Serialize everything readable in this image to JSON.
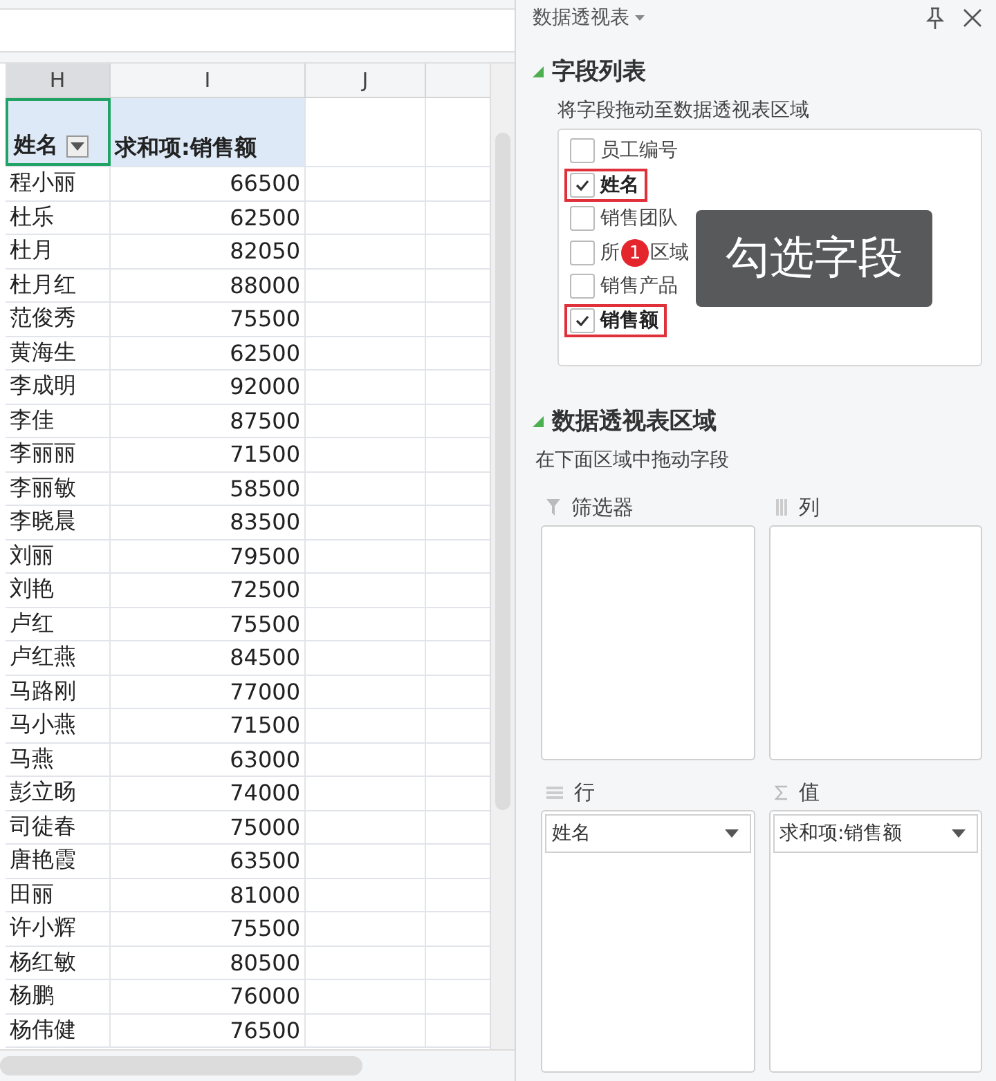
{
  "sheet": {
    "columns": [
      {
        "label": "H",
        "selected": true
      },
      {
        "label": "I",
        "selected": false
      },
      {
        "label": "J",
        "selected": false
      }
    ],
    "pivot_header": {
      "row_label": "姓名",
      "value_label": "求和项:销售额"
    },
    "rows": [
      {
        "name": "程小丽",
        "value": "66500"
      },
      {
        "name": "杜乐",
        "value": "62500"
      },
      {
        "name": "杜月",
        "value": "82050"
      },
      {
        "name": "杜月红",
        "value": "88000"
      },
      {
        "name": "范俊秀",
        "value": "75500"
      },
      {
        "name": "黄海生",
        "value": "62500"
      },
      {
        "name": "李成明",
        "value": "92000"
      },
      {
        "name": "李佳",
        "value": "87500"
      },
      {
        "name": "李丽丽",
        "value": "71500"
      },
      {
        "name": "李丽敏",
        "value": "58500"
      },
      {
        "name": "李晓晨",
        "value": "83500"
      },
      {
        "name": "刘丽",
        "value": "79500"
      },
      {
        "name": "刘艳",
        "value": "72500"
      },
      {
        "name": "卢红",
        "value": "75500"
      },
      {
        "name": "卢红燕",
        "value": "84500"
      },
      {
        "name": "马路刚",
        "value": "77000"
      },
      {
        "name": "马小燕",
        "value": "71500"
      },
      {
        "name": "马燕",
        "value": "63000"
      },
      {
        "name": "彭立旸",
        "value": "74000"
      },
      {
        "name": "司徒春",
        "value": "75000"
      },
      {
        "name": "唐艳霞",
        "value": "63500"
      },
      {
        "name": "田丽",
        "value": "81000"
      },
      {
        "name": "许小辉",
        "value": "75500"
      },
      {
        "name": "杨红敏",
        "value": "80500"
      },
      {
        "name": "杨鹏",
        "value": "76000"
      },
      {
        "name": "杨伟健",
        "value": "76500"
      }
    ]
  },
  "panel": {
    "title": "数据透视表",
    "field_list": {
      "heading": "字段列表",
      "hint": "将字段拖动至数据透视表区域",
      "fields": [
        {
          "label": "员工编号",
          "checked": false,
          "highlighted": false
        },
        {
          "label": "姓名",
          "checked": true,
          "highlighted": true
        },
        {
          "label": "销售团队",
          "checked": false,
          "highlighted": false
        },
        {
          "label": "所",
          "label_tail": "区域",
          "checked": false,
          "highlighted": false
        },
        {
          "label": "销售产品",
          "checked": false,
          "highlighted": false
        },
        {
          "label": "销售额",
          "checked": true,
          "highlighted": true
        }
      ]
    },
    "areas": {
      "heading": "数据透视表区域",
      "hint": "在下面区域中拖动字段",
      "zones": [
        {
          "kind": "filter",
          "label": "筛选器"
        },
        {
          "kind": "columns",
          "label": "列"
        },
        {
          "kind": "rows",
          "label": "行",
          "items": [
            "姓名"
          ]
        },
        {
          "kind": "values",
          "label": "值",
          "items": [
            "求和项:销售额"
          ]
        }
      ]
    }
  },
  "callout": {
    "badge": "1",
    "text": "勾选字段"
  }
}
